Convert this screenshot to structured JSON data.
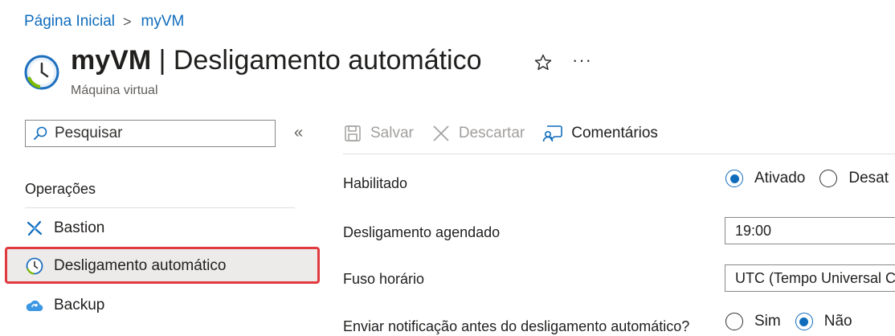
{
  "breadcrumb": {
    "home": "Página Inicial",
    "separator": ">",
    "current": "myVM"
  },
  "header": {
    "title_resource": "myVM",
    "title_separator": " | ",
    "title_page": "Desligamento automático",
    "subtitle": "Máquina virtual",
    "more": "···",
    "icon": "clock-icon",
    "favorite_icon": "star-icon"
  },
  "sidebar": {
    "search_placeholder": "Pesquisar",
    "collapse": "«",
    "section": "Operações",
    "items": [
      {
        "label": "Bastion",
        "icon": "bastion-icon"
      },
      {
        "label": "Desligamento automático",
        "icon": "clock-icon",
        "active": true
      },
      {
        "label": "Backup",
        "icon": "backup-cloud-icon"
      }
    ]
  },
  "toolbar": {
    "save": "Salvar",
    "discard": "Descartar",
    "feedback": "Comentários"
  },
  "form": {
    "enabled_label": "Habilitado",
    "enabled_options": {
      "on": "Ativado",
      "off": "Desat"
    },
    "enabled_value": "Ativado",
    "time_label": "Desligamento agendado",
    "time_value": "19:00",
    "timezone_label": "Fuso horário",
    "timezone_value": "UTC (Tempo Universal C",
    "notify_label": "Enviar notificação antes do desligamento automático?",
    "notify_options": {
      "yes": "Sim",
      "no": "Não"
    },
    "notify_value": "Não"
  },
  "colors": {
    "accent": "#0f6cbd",
    "highlight_border": "#e0393e",
    "active_bg": "#edebe9"
  }
}
